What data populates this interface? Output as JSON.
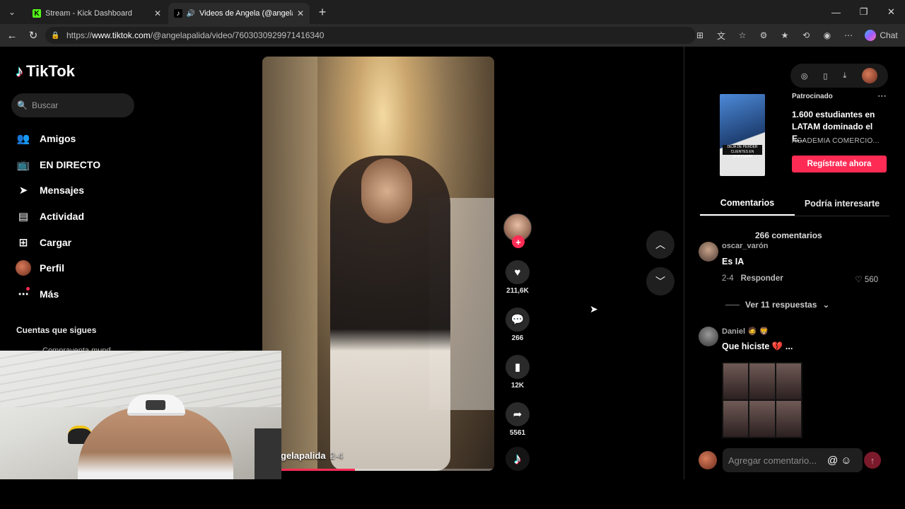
{
  "browser": {
    "tabs": [
      {
        "title": "Stream - Kick Dashboard",
        "favicon": "K",
        "active": false
      },
      {
        "title": "Videos de Angela (@angelapalida)",
        "favicon": "tiktok-icon",
        "active": true
      }
    ],
    "url_prefix": "https://",
    "url_domain": "www.tiktok.com",
    "url_path": "/@angelapalida/video/7603030929971416340",
    "chat_label": "Chat"
  },
  "sidebar": {
    "logo_text": "TikTok",
    "search_placeholder": "Buscar",
    "items": [
      {
        "label": "Amigos",
        "icon": "friends-icon"
      },
      {
        "label": "EN DIRECTO",
        "icon": "live-icon"
      },
      {
        "label": "Mensajes",
        "icon": "messages-icon"
      },
      {
        "label": "Actividad",
        "icon": "activity-icon"
      },
      {
        "label": "Cargar",
        "icon": "upload-icon"
      },
      {
        "label": "Perfil",
        "icon": "profile-avatar"
      },
      {
        "label": "Más",
        "icon": "more-icon"
      }
    ],
    "following_title": "Cuentas que sigues",
    "following_first": "Compraventa mund"
  },
  "video": {
    "username": "gelapalida",
    "date": "2-4",
    "progress": 0.4
  },
  "actions": {
    "likes": "211,6K",
    "comments": "266",
    "saves": "12K",
    "shares": "5561"
  },
  "ad": {
    "sponsored": "Patrocinado",
    "title": "1.600 estudiantes en LATAM dominado el E...",
    "brand": "ACADEMIA COMERCIO...",
    "cta": "Regístrate ahora",
    "thumb_tag": "DEJA DE PERDER CLIENTES EN WHATSAPP!"
  },
  "panel_tabs": [
    "Comentarios",
    "Podría interesarte"
  ],
  "comments": {
    "count_label": "266 comentarios",
    "items": [
      {
        "user": "oscar_varón",
        "text": "Es IA",
        "date": "2-4",
        "reply": "Responder",
        "likes": "560"
      },
      {
        "user": "Daniel 🧔 🦁",
        "text": "Que hiciste 💔 ..."
      }
    ],
    "view_replies": "Ver 11 respuestas",
    "composer_placeholder": "Agregar comentario..."
  }
}
